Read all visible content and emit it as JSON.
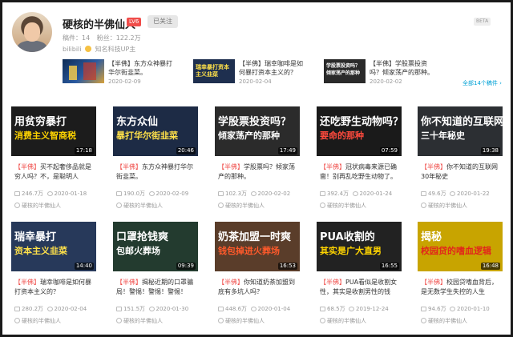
{
  "header": {
    "name": "硬核的半佛仙人",
    "level": "LV6",
    "follow_label": "已关注",
    "stats": {
      "videos_label": "稿件：14",
      "fans_label": "粉丝：122.2万"
    },
    "verify": {
      "prefix": "bilibili",
      "text": "知名科技UP主"
    },
    "beta": "BETA"
  },
  "recent": [
    {
      "title": "【半佛】东方众神暴打华尔街韭菜。",
      "date": "2020-02-09",
      "thumb_text": ""
    },
    {
      "title": "【半佛】瑞幸咖啡是如何暴打资本主义的？",
      "date": "2020-02-04",
      "thumb_text": "瑞幸暴打资本主义韭菜"
    },
    {
      "title": "【半佛】学股票投资吗？倾家荡产的那种。",
      "date": "2020-02-02",
      "thumb_text": "学股票投资吗？倾家荡产的那种"
    }
  ],
  "all_videos_label": "全部14个稿件 ›",
  "videos": [
    {
      "title_tag": "【半佛】",
      "title": "买不起奢侈品就是穷人吗？不，是聪明人",
      "views": "246.7万",
      "date": "2020-01-18",
      "duration": "17:18",
      "author": "硬核的半佛仙人",
      "thumb": [
        "用贫穷暴打",
        "消费主义智商税"
      ],
      "bg": "#1c1c1c"
    },
    {
      "title_tag": "【半佛】",
      "title": "东方众神暴打华尔街韭菜。",
      "views": "190.0万",
      "date": "2020-02-09",
      "duration": "20:46",
      "author": "硬核的半佛仙人",
      "thumb": [
        "东方众仙",
        "暴打华尔街韭菜"
      ],
      "bg": "#1d2b45"
    },
    {
      "title_tag": "【半佛】",
      "title": "学股票吗？倾家荡产的那种。",
      "views": "102.3万",
      "date": "2020-02-02",
      "duration": "17:49",
      "author": "硬核的半佛仙人",
      "thumb": [
        "学股票投资吗？",
        "倾家荡产的那种"
      ],
      "bg": "#2b2b2b"
    },
    {
      "title_tag": "【半佛】",
      "title": "冠状病毒来源已确凿！别再乱吃野生动物了。",
      "views": "392.4万",
      "date": "2020-01-24",
      "duration": "07:59",
      "author": "硬核的半佛仙人",
      "thumb": [
        "还吃野生动物吗？",
        "要命的那种"
      ],
      "bg": "#1a1a1a"
    },
    {
      "title_tag": "【半佛】",
      "title": "你不知道的互联网30年秘史",
      "views": "49.6万",
      "date": "2020-01-22",
      "duration": "19:38",
      "author": "硬核的半佛仙人",
      "thumb": [
        "你不知道的互联网",
        "三十年秘史"
      ],
      "bg": "#2c2f33"
    },
    {
      "title_tag": "【半佛】",
      "title": "瑞幸咖啡是如何暴打资本主义的？",
      "views": "280.2万",
      "date": "2020-02-04",
      "duration": "14:40",
      "author": "硬核的半佛仙人",
      "thumb": [
        "瑞幸暴打",
        "资本主义韭菜"
      ],
      "bg": "#27395a"
    },
    {
      "title_tag": "【半佛】",
      "title": "揭秘近期的口罩骗局！警惕！警惕！警惕！",
      "views": "151.5万",
      "date": "2020-01-30",
      "duration": "09:39",
      "author": "硬核的半佛仙人",
      "thumb": [
        "口罩抢钱爽",
        "包邮火葬场"
      ],
      "bg": "#233b2f"
    },
    {
      "title_tag": "【半佛】",
      "title": "你知道奶茶加盟到底有多坑人吗？",
      "views": "448.6万",
      "date": "2020-01-04",
      "duration": "16:53",
      "author": "硬核的半佛仙人",
      "thumb": [
        "奶茶加盟一时爽",
        "钱包掉进火葬场"
      ],
      "bg": "#5a3d2a"
    },
    {
      "title_tag": "【半佛】",
      "title": "PUA看似是收割女性，其实是收割男性的钱",
      "views": "68.5万",
      "date": "2019-12-24",
      "duration": "16:55",
      "author": "硬核的半佛仙人",
      "thumb": [
        "PUA收割的",
        "其实是广大直男"
      ],
      "bg": "#222"
    },
    {
      "title_tag": "【半佛】",
      "title": "校园贷嗜血背后，是无数学生失控的人生",
      "views": "94.6万",
      "date": "2020-01-10",
      "duration": "16:48",
      "author": "硬核的半佛仙人",
      "thumb": [
        "揭秘",
        "校园贷的嗜血逻辑"
      ],
      "bg": "#c8a400"
    }
  ]
}
